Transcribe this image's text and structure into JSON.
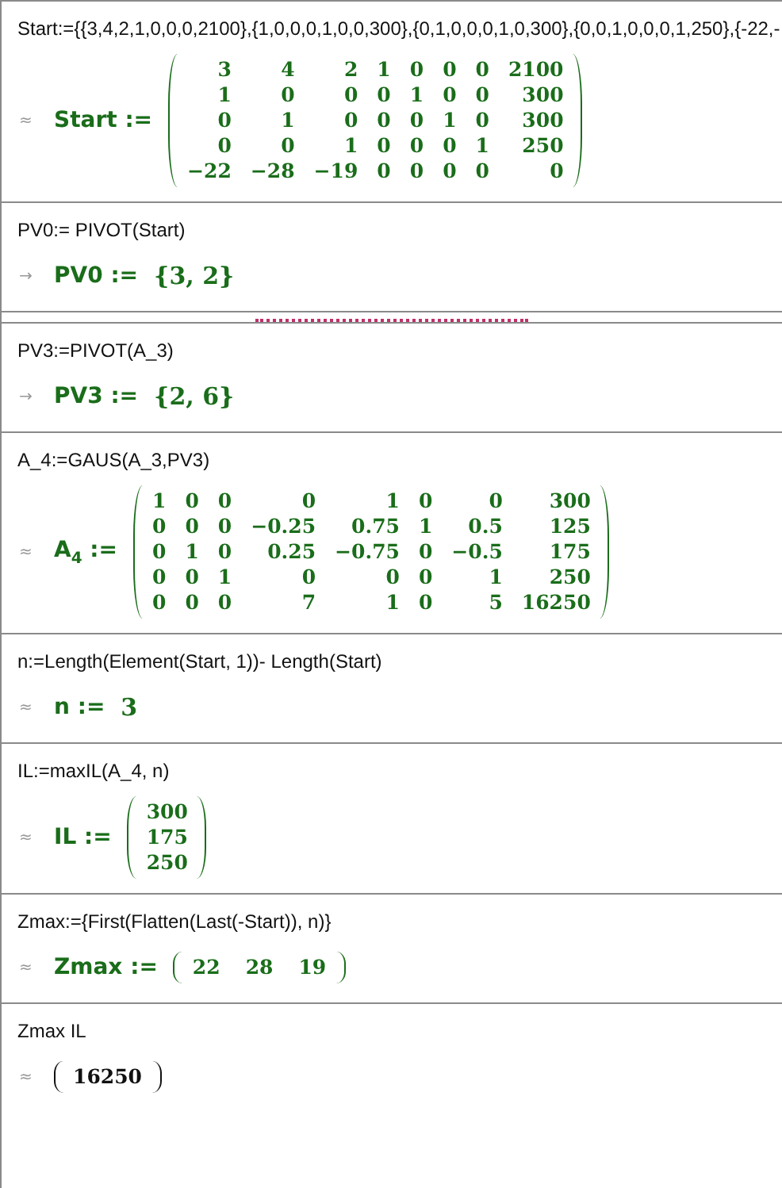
{
  "cells": [
    {
      "input": "Start:={{3,4,2,1,0,0,0,2100},{1,0,0,0,1,0,0,300},{0,1,0,0,0,1,0,300},{0,0,1,0,0,0,1,250},{-22,-",
      "insert_marker": false,
      "output": {
        "marker": "≈",
        "label": "Start :=",
        "kind": "matrix",
        "assigned": true,
        "rows": [
          [
            "3",
            "4",
            "2",
            "1",
            "0",
            "0",
            "0",
            "2100"
          ],
          [
            "1",
            "0",
            "0",
            "0",
            "1",
            "0",
            "0",
            "300"
          ],
          [
            "0",
            "1",
            "0",
            "0",
            "0",
            "1",
            "0",
            "300"
          ],
          [
            "0",
            "0",
            "1",
            "0",
            "0",
            "0",
            "1",
            "250"
          ],
          [
            "−22",
            "−28",
            "−19",
            "0",
            "0",
            "0",
            "0",
            "0"
          ]
        ]
      }
    },
    {
      "input": "PV0:= PIVOT(Start)",
      "insert_marker": true,
      "output": {
        "marker": "→",
        "label": "PV0 :=",
        "kind": "set",
        "assigned": true,
        "value": "{3, 2}"
      }
    },
    {
      "input": "PV3:=PIVOT(A_3)",
      "insert_marker": false,
      "output": {
        "marker": "→",
        "label": "PV3 :=",
        "kind": "set",
        "assigned": true,
        "value": "{2, 6}"
      }
    },
    {
      "input": "A_4:=GAUS(A_3,PV3)",
      "insert_marker": false,
      "output": {
        "marker": "≈",
        "label": "A$_{4}$ :=",
        "kind": "matrix",
        "assigned": true,
        "rows": [
          [
            "1",
            "0",
            "0",
            "0",
            "1",
            "0",
            "0",
            "300"
          ],
          [
            "0",
            "0",
            "0",
            "−0.25",
            "0.75",
            "1",
            "0.5",
            "125"
          ],
          [
            "0",
            "1",
            "0",
            "0.25",
            "−0.75",
            "0",
            "−0.5",
            "175"
          ],
          [
            "0",
            "0",
            "1",
            "0",
            "0",
            "0",
            "1",
            "250"
          ],
          [
            "0",
            "0",
            "0",
            "7",
            "1",
            "0",
            "5",
            "16250"
          ]
        ]
      }
    },
    {
      "input": "n:=Length(Element(Start, 1))- Length(Start)",
      "insert_marker": false,
      "output": {
        "marker": "≈",
        "label": "n :=",
        "kind": "text",
        "assigned": true,
        "value": "3"
      }
    },
    {
      "input": "IL:=maxIL(A_4, n)",
      "insert_marker": false,
      "output": {
        "marker": "≈",
        "label": "IL :=",
        "kind": "matrix",
        "assigned": true,
        "rows": [
          [
            "300"
          ],
          [
            "175"
          ],
          [
            "250"
          ]
        ]
      }
    },
    {
      "input": "Zmax:={First(Flatten(Last(-Start)), n)}",
      "insert_marker": false,
      "output": {
        "marker": "≈",
        "label": "Zmax :=",
        "kind": "matrix",
        "assigned": true,
        "rows": [
          [
            "22",
            "28",
            "19"
          ]
        ]
      }
    },
    {
      "input": "Zmax IL",
      "insert_marker": false,
      "output": {
        "marker": "≈",
        "kind": "matrix",
        "assigned": false,
        "rows": [
          [
            "16250"
          ]
        ]
      }
    }
  ]
}
